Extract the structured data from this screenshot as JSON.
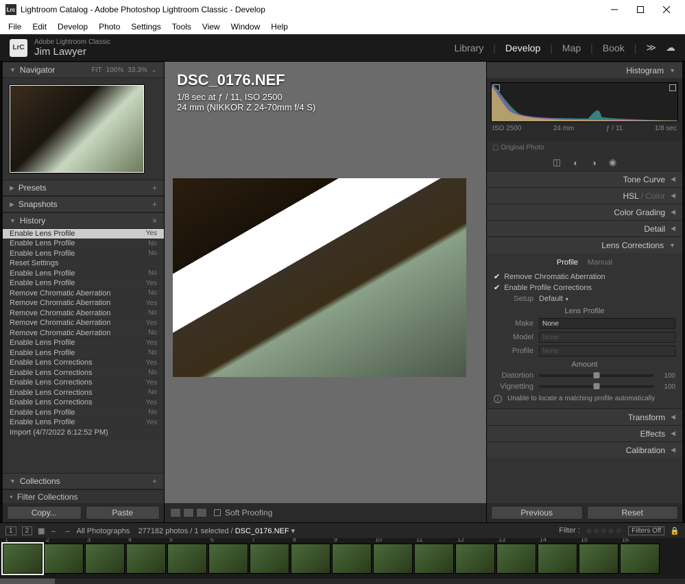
{
  "window": {
    "title": "Lightroom Catalog - Adobe Photoshop Lightroom Classic - Develop"
  },
  "menu": [
    "File",
    "Edit",
    "Develop",
    "Photo",
    "Settings",
    "Tools",
    "View",
    "Window",
    "Help"
  ],
  "identity": {
    "product": "Adobe Lightroom Classic",
    "user": "Jim Lawyer",
    "logo": "LrC"
  },
  "modules": {
    "items": [
      "Library",
      "Develop",
      "Map",
      "Book"
    ],
    "active": "Develop"
  },
  "navigator": {
    "title": "Navigator",
    "opts": [
      "FIT",
      "100%",
      "33.3%"
    ]
  },
  "panels_left": {
    "presets": "Presets",
    "snapshots": "Snapshots",
    "history": "History",
    "collections": "Collections",
    "filter_collections": "Filter Collections"
  },
  "history_items": [
    {
      "label": "Enable Lens Profile",
      "val": "Yes",
      "sel": true
    },
    {
      "label": "Enable Lens Profile",
      "val": "No"
    },
    {
      "label": "Enable Lens Profile",
      "val": "No"
    },
    {
      "label": "Reset Settings",
      "val": ""
    },
    {
      "label": "Enable Lens Profile",
      "val": "No"
    },
    {
      "label": "Enable Lens Profile",
      "val": "Yes"
    },
    {
      "label": "Remove Chromatic Aberration",
      "val": "No"
    },
    {
      "label": "Remove Chromatic Aberration",
      "val": "Yes"
    },
    {
      "label": "Remove Chromatic Aberration",
      "val": "No"
    },
    {
      "label": "Remove Chromatic Aberration",
      "val": "Yes"
    },
    {
      "label": "Remove Chromatic Aberration",
      "val": "No"
    },
    {
      "label": "Enable Lens Profile",
      "val": "Yes"
    },
    {
      "label": "Enable Lens Profile",
      "val": "No"
    },
    {
      "label": "Enable Lens Corrections",
      "val": "Yes"
    },
    {
      "label": "Enable Lens Corrections",
      "val": "No"
    },
    {
      "label": "Enable Lens Corrections",
      "val": "Yes"
    },
    {
      "label": "Enable Lens Corrections",
      "val": "No"
    },
    {
      "label": "Enable Lens Corrections",
      "val": "Yes"
    },
    {
      "label": "Enable Lens Profile",
      "val": "No"
    },
    {
      "label": "Enable Lens Profile",
      "val": "Yes"
    },
    {
      "label": "Import (4/7/2022 6:12:52 PM)",
      "val": ""
    }
  ],
  "buttons": {
    "copy": "Copy...",
    "paste": "Paste",
    "previous": "Previous",
    "reset": "Reset"
  },
  "overlay": {
    "file": "DSC_0176.NEF",
    "exposure": "1/8 sec at ƒ / 11, ISO 2500",
    "lens": "24 mm (NIKKOR Z 24-70mm f/4 S)"
  },
  "soft_proofing": "Soft Proofing",
  "histogram": {
    "title": "Histogram",
    "meta": [
      "ISO 2500",
      "24 mm",
      "ƒ / 11",
      "1/8 sec"
    ],
    "original": "Original Photo"
  },
  "rpanels": {
    "tone_curve": "Tone Curve",
    "hsl": "HSL",
    "color": "Color",
    "color_grading": "Color Grading",
    "detail": "Detail",
    "lens_corrections": "Lens Corrections",
    "transform": "Transform",
    "effects": "Effects",
    "calibration": "Calibration"
  },
  "lens": {
    "tabs": {
      "profile": "Profile",
      "manual": "Manual"
    },
    "remove_ca": "Remove Chromatic Aberration",
    "enable_profile": "Enable Profile Corrections",
    "setup_label": "Setup",
    "setup_value": "Default",
    "lens_profile": "Lens Profile",
    "make": "Make",
    "make_value": "None",
    "model": "Model",
    "model_value": "None",
    "profile": "Profile",
    "profile_value": "None",
    "amount": "Amount",
    "distortion": "Distortion",
    "distortion_val": "100",
    "vignetting": "Vignetting",
    "vignetting_val": "100",
    "warning": "Unable to locate a matching profile automatically"
  },
  "filmstrip": {
    "monitor1": "1",
    "monitor2": "2",
    "source": "All Photographs",
    "count": "277182 photos / 1 selected /",
    "file": "DSC_0176.NEF",
    "filter_label": "Filter :",
    "filters_off": "Filters Off",
    "thumbs": [
      "1",
      "2",
      "3",
      "4",
      "5",
      "6",
      "7",
      "8",
      "9",
      "10",
      "11",
      "12",
      "13",
      "14",
      "15",
      "16"
    ]
  }
}
